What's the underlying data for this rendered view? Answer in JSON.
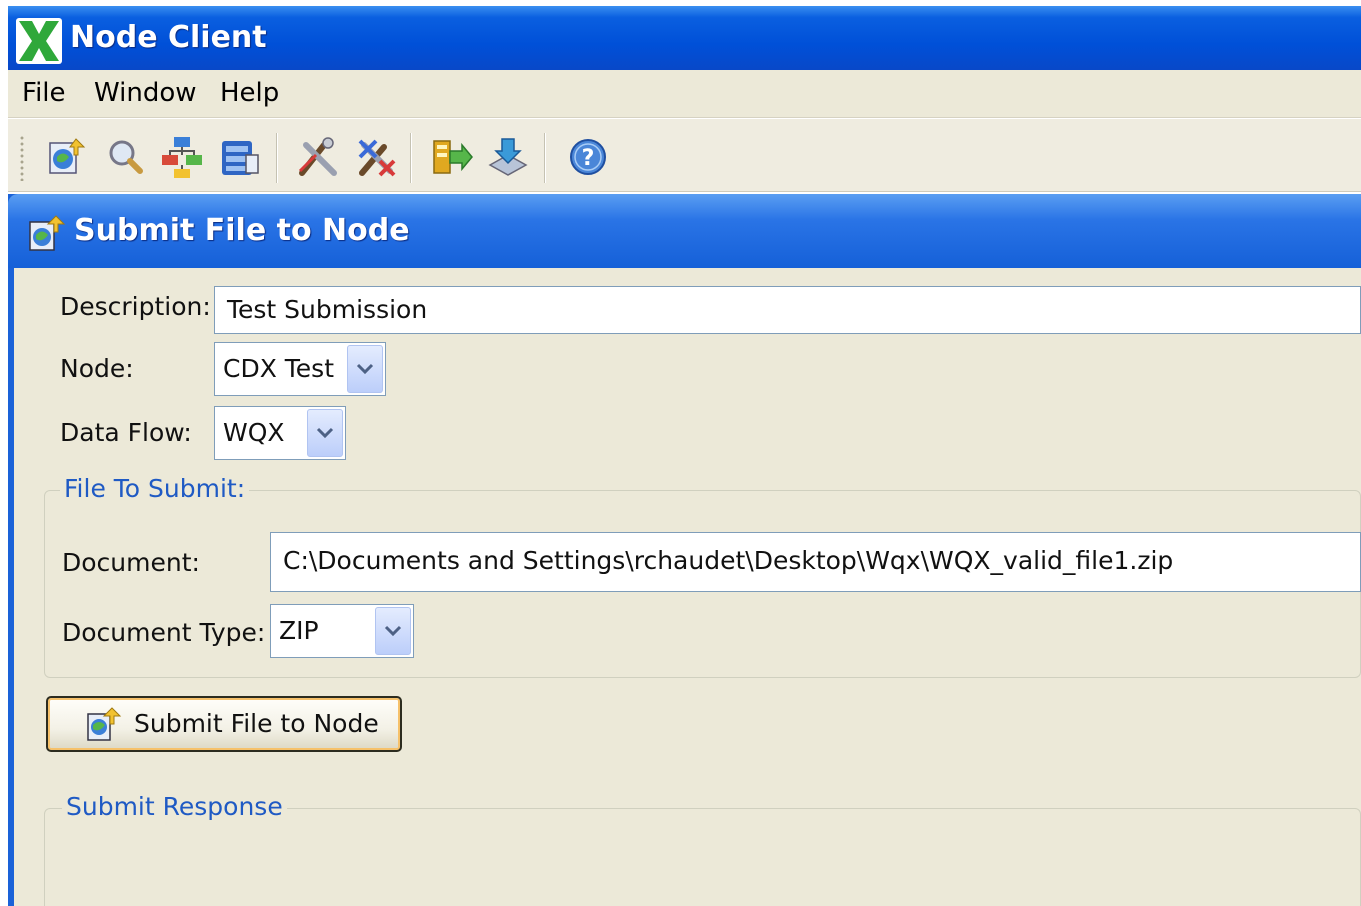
{
  "window": {
    "title": "Node Client"
  },
  "menu": [
    {
      "label": "File"
    },
    {
      "label": "Window"
    },
    {
      "label": "Help"
    }
  ],
  "toolbar": {
    "buttons": [
      {
        "icon": "submit-file-icon"
      },
      {
        "icon": "search-icon"
      },
      {
        "icon": "node-tree-icon"
      },
      {
        "icon": "database-icon"
      },
      {
        "icon": "tools-icon"
      },
      {
        "icon": "delete-tools-icon"
      },
      {
        "icon": "run-flow-icon"
      },
      {
        "icon": "download-icon"
      },
      {
        "icon": "help-icon"
      }
    ]
  },
  "panel": {
    "title": "Submit File to Node",
    "description": {
      "label": "Description:",
      "value": "Test Submission"
    },
    "node": {
      "label": "Node:",
      "value": "CDX Test"
    },
    "data_flow": {
      "label": "Data Flow:",
      "value": "WQX"
    },
    "file_group": {
      "title": "File To Submit:",
      "document": {
        "label": "Document:",
        "value": "C:\\Documents and Settings\\rchaudet\\Desktop\\Wqx\\WQX_valid_file1.zip"
      },
      "document_type": {
        "label": "Document Type:",
        "value": "ZIP"
      }
    },
    "submit_button": {
      "label": "Submit File to Node"
    },
    "response_group": {
      "title": "Submit Response"
    }
  },
  "colors": {
    "title_bar": "#0050d8",
    "panel_header": "#1560d8",
    "face": "#ece9d8",
    "group_title": "#1f5ac4",
    "button_focus": "#f6c16a"
  }
}
